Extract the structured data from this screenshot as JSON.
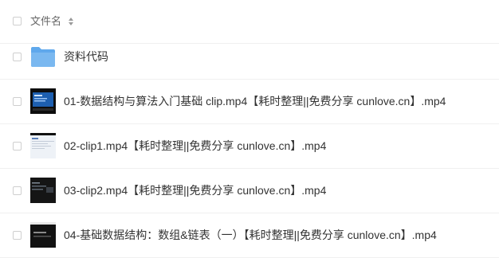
{
  "header": {
    "column_label": "文件名"
  },
  "files": [
    {
      "name": "资料代码",
      "icon": "folder-icon"
    },
    {
      "name": "01-数据结构与算法入门基础 clip.mp4【耗时整理||免费分享 cunlove.cn】.mp4",
      "icon": "video-thumbnail"
    },
    {
      "name": "02-clip1.mp4【耗时整理||免费分享 cunlove.cn】.mp4",
      "icon": "video-thumbnail"
    },
    {
      "name": "03-clip2.mp4【耗时整理||免费分享 cunlove.cn】.mp4",
      "icon": "video-thumbnail"
    },
    {
      "name": "04-基础数据结构：数组&链表（一）【耗时整理||免费分享 cunlove.cn】.mp4",
      "icon": "video-thumbnail"
    }
  ],
  "colors": {
    "folder": "#5fa8ec",
    "text": "#333333",
    "muted": "#666666",
    "divider": "#f0f0f0"
  }
}
